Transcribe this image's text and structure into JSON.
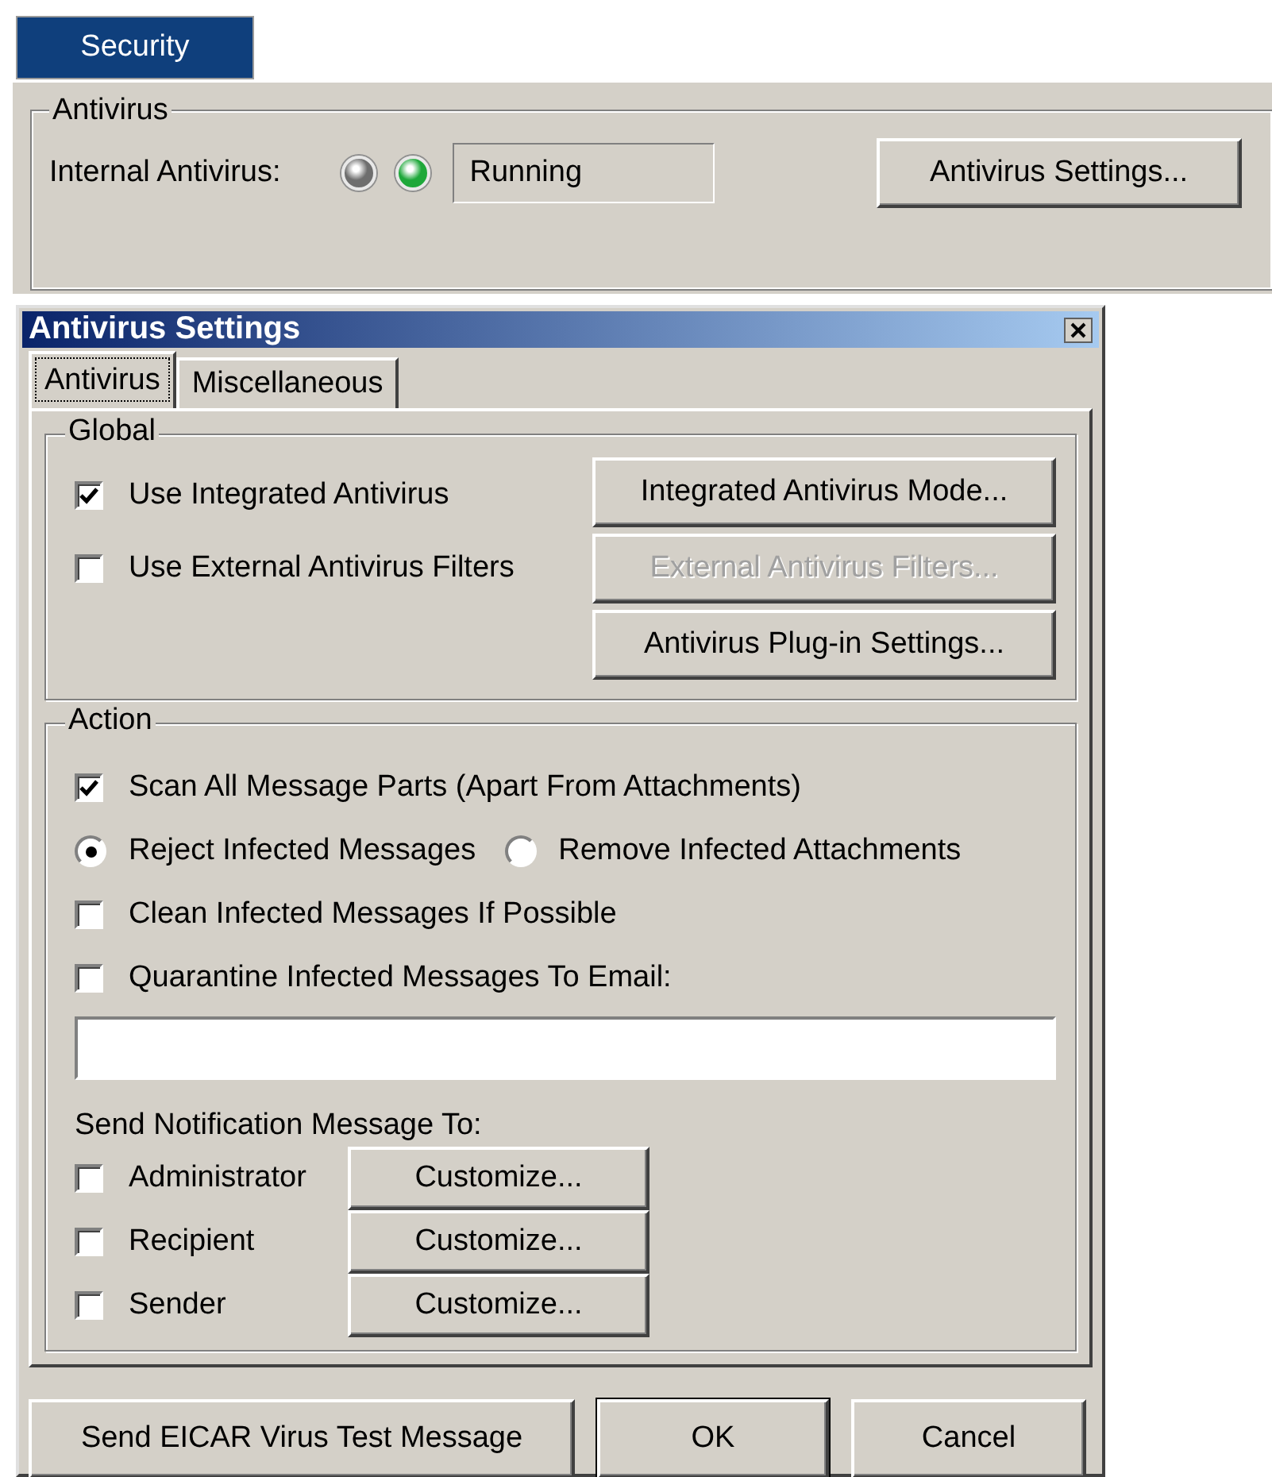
{
  "top_tabs": [
    {
      "label": "Security",
      "selected": true
    }
  ],
  "antivirus_group": {
    "title": "Antivirus",
    "label": "Internal Antivirus:",
    "lights": [
      {
        "color": "#6e6e6e"
      },
      {
        "color": "#1ea83a"
      }
    ],
    "status": "Running",
    "button": "Antivirus Settings..."
  },
  "dialog": {
    "title": "Antivirus Settings",
    "tabs": [
      {
        "label": "Antivirus",
        "selected": true
      },
      {
        "label": "Miscellaneous",
        "selected": false
      }
    ],
    "global": {
      "title": "Global",
      "options": [
        {
          "label": "Use Integrated Antivirus",
          "checked": true
        },
        {
          "label": "Use External Antivirus Filters",
          "checked": false
        }
      ],
      "buttons": [
        {
          "label": "Integrated Antivirus Mode...",
          "disabled": false
        },
        {
          "label": "External Antivirus Filters...",
          "disabled": true
        },
        {
          "label": "Antivirus Plug-in Settings...",
          "disabled": false
        }
      ]
    },
    "action": {
      "title": "Action",
      "items": [
        {
          "kind": "checkbox",
          "label": "Scan All Message Parts (Apart From Attachments)",
          "checked": true
        },
        {
          "kind": "radios",
          "options": [
            {
              "label": "Reject Infected Messages",
              "selected": true
            },
            {
              "label": "Remove Infected Attachments",
              "selected": false
            }
          ]
        },
        {
          "kind": "checkbox",
          "label": "Clean Infected Messages If Possible",
          "checked": false
        },
        {
          "kind": "checkbox",
          "label": "Quarantine Infected Messages To Email:",
          "checked": false
        },
        {
          "kind": "field"
        }
      ],
      "notify_label": "Send Notification Message To:",
      "recipients": [
        {
          "label": "Administrator",
          "checked": false,
          "button": "Customize..."
        },
        {
          "label": "Recipient",
          "checked": false,
          "button": "Customize..."
        },
        {
          "label": "Sender",
          "checked": false,
          "button": "Customize..."
        }
      ]
    },
    "footer_buttons": [
      {
        "label": "Send EICAR Virus Test Message",
        "default": false
      },
      {
        "label": "OK",
        "default": true
      },
      {
        "label": "Cancel",
        "default": false
      }
    ]
  }
}
